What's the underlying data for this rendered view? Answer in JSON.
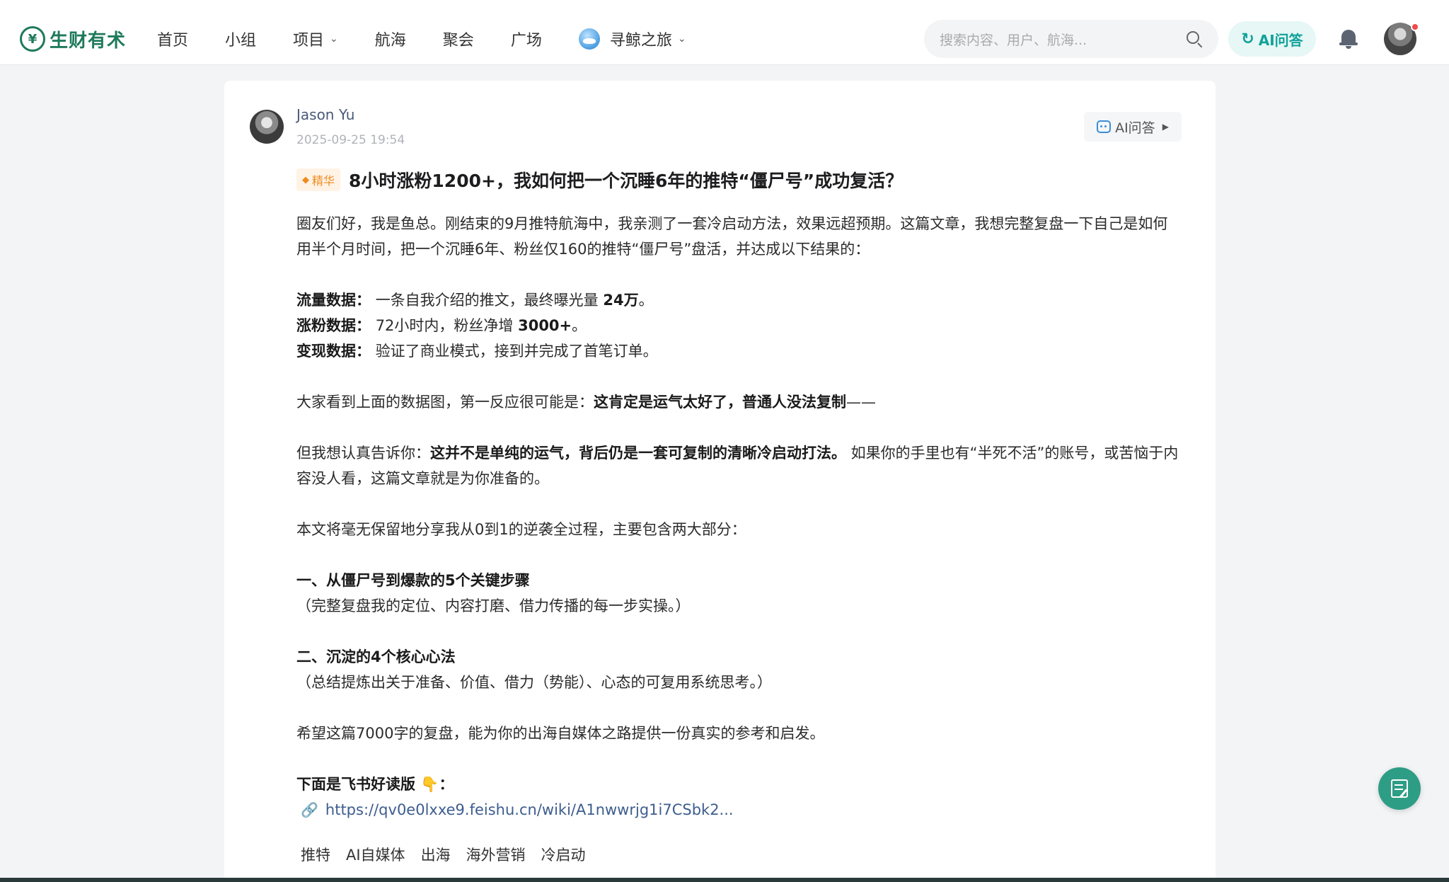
{
  "header": {
    "logo_mark": "¥",
    "logo_text": "生财有术",
    "nav": [
      "首页",
      "小组",
      "项目",
      "航海",
      "聚会",
      "广场"
    ],
    "nav_special": "寻鲸之旅",
    "search_placeholder": "搜索内容、用户、航海...",
    "ai_label": "AI问答"
  },
  "post": {
    "author": "Jason Yu",
    "time": "2025-09-25 19:54",
    "ai_ask": "AI问答",
    "badge": "精华",
    "title": "8小时涨粉1200+，我如何把一个沉睡6年的推特“僵尸号”成功复活？",
    "intro": "圈友们好，我是鱼总。刚结束的9月推特航海中，我亲测了一套冷启动方法，效果远超预期。这篇文章，我想完整复盘一下自己是如何用半个月时间，把一个沉睡6年、粉丝仅160的推特“僵尸号”盘活，并达成以下结果的：",
    "stats": [
      {
        "label": "流量数据：",
        "text": "一条自我介绍的推文，最终曝光量 ",
        "bold": "24万",
        "end": "。"
      },
      {
        "label": "涨粉数据：",
        "text": "72小时内，粉丝净增 ",
        "bold": "3000+",
        "end": "。"
      },
      {
        "label": "变现数据：",
        "text": "验证了商业模式，接到并完成了首笔订单。",
        "bold": "",
        "end": ""
      }
    ],
    "p2_a": "大家看到上面的数据图，第一反应很可能是：",
    "p2_b": "这肯定是运气太好了，普通人没法复制",
    "p2_c": "——",
    "p3_a": "但我想认真告诉你：",
    "p3_b": "这并不是单纯的运气，背后仍是一套可复制的清晰冷启动打法。",
    "p3_c": " 如果你的手里也有“半死不活”的账号，或苦恼于内容没人看，这篇文章就是为你准备的。",
    "p4": "本文将毫无保留地分享我从0到1的逆袭全过程，主要包含两大部分：",
    "s1_title": "一、从僵尸号到爆款的5个关键步骤",
    "s1_desc": "（完整复盘我的定位、内容打磨、借力传播的每一步实操。）",
    "s2_title": "二、沉淀的4个核心心法",
    "s2_desc": "（总结提炼出关于准备、价值、借力（势能）、心态的可复用系统思考。）",
    "p5": "希望这篇7000字的复盘，能为你的出海自媒体之路提供一份真实的参考和启发。",
    "feishu_label": "下面是飞书好读版 👇：",
    "link": "https://qv0e0lxxe9.feishu.cn/wiki/A1nwwrjg1i7CSbk2...",
    "tags": [
      "推特",
      "AI自媒体",
      "出海",
      "海外营销",
      "冷启动"
    ]
  }
}
